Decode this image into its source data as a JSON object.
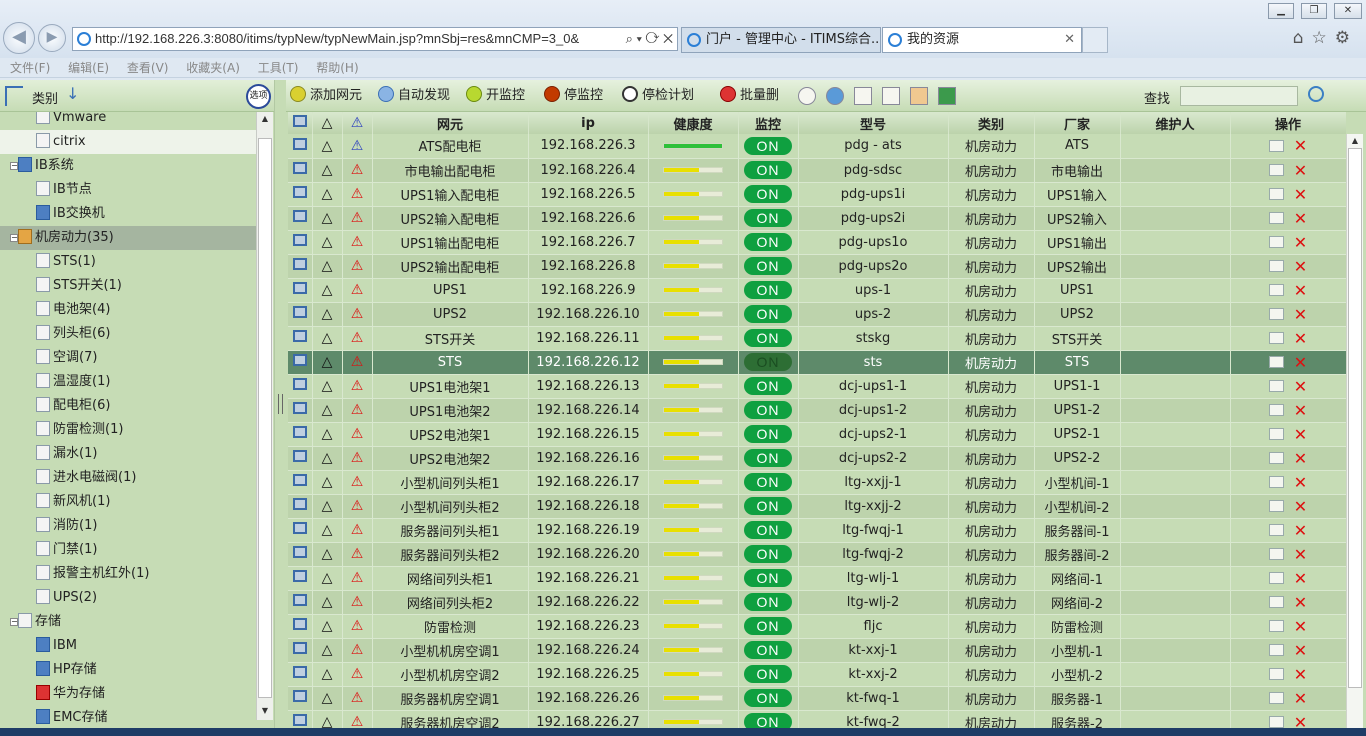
{
  "browser": {
    "url": "http://192.168.226.3:8080/itims/typNew/typNewMain.jsp?mnSbj=res&mnCMP=3_0&",
    "tabs": [
      {
        "label": "门户 - 管理中心 - ITIMS综合..."
      },
      {
        "label": "我的资源"
      }
    ]
  },
  "menu": [
    "文件(F)",
    "编辑(E)",
    "查看(V)",
    "收藏夹(A)",
    "工具(T)",
    "帮助(H)"
  ],
  "left": {
    "header_label": "类别",
    "options_label": "选项",
    "tree": [
      {
        "label": "Vmware",
        "level": 2,
        "icon": "vm"
      },
      {
        "label": "citrix",
        "level": 2,
        "icon": "citrix",
        "selected": true
      },
      {
        "label": "IB系统",
        "level": 1,
        "expander": "−",
        "icon": "ib"
      },
      {
        "label": "IB节点",
        "level": 2,
        "icon": "doc"
      },
      {
        "label": "IB交换机",
        "level": 2,
        "icon": "switch"
      },
      {
        "label": "机房动力(35)",
        "level": 1,
        "expander": "−",
        "icon": "power",
        "highlight": true
      },
      {
        "label": "STS(1)",
        "level": 2,
        "icon": "doc"
      },
      {
        "label": "STS开关(1)",
        "level": 2,
        "icon": "doc"
      },
      {
        "label": "电池架(4)",
        "level": 2,
        "icon": "doc"
      },
      {
        "label": "列头柜(6)",
        "level": 2,
        "icon": "doc"
      },
      {
        "label": "空调(7)",
        "level": 2,
        "icon": "doc"
      },
      {
        "label": "温湿度(1)",
        "level": 2,
        "icon": "doc"
      },
      {
        "label": "配电柜(6)",
        "level": 2,
        "icon": "doc"
      },
      {
        "label": "防雷检测(1)",
        "level": 2,
        "icon": "doc"
      },
      {
        "label": "漏水(1)",
        "level": 2,
        "icon": "doc"
      },
      {
        "label": "进水电磁阀(1)",
        "level": 2,
        "icon": "doc"
      },
      {
        "label": "新风机(1)",
        "level": 2,
        "icon": "doc"
      },
      {
        "label": "消防(1)",
        "level": 2,
        "icon": "doc"
      },
      {
        "label": "门禁(1)",
        "level": 2,
        "icon": "doc"
      },
      {
        "label": "报警主机红外(1)",
        "level": 2,
        "icon": "doc"
      },
      {
        "label": "UPS(2)",
        "level": 2,
        "icon": "doc"
      },
      {
        "label": "存储",
        "level": 1,
        "expander": "−",
        "icon": "storage"
      },
      {
        "label": "IBM",
        "level": 2,
        "icon": "ibm"
      },
      {
        "label": "HP存储",
        "level": 2,
        "icon": "hp"
      },
      {
        "label": "华为存储",
        "level": 2,
        "icon": "huawei"
      },
      {
        "label": "EMC存储",
        "level": 2,
        "icon": "emc"
      }
    ]
  },
  "toolbar": {
    "add": "添加网元",
    "discover": "自动发现",
    "start_monitor": "开监控",
    "stop_monitor": "停监控",
    "stop_plan": "停检计划",
    "batch_delete": "批量删",
    "search_label": "查找",
    "search_value": ""
  },
  "table": {
    "headers": [
      "网元",
      "ip",
      "健康度",
      "监控",
      "型号",
      "类别",
      "厂家",
      "维护人",
      "操作"
    ],
    "on_label": "ON",
    "rows": [
      {
        "name": "ATS配电柜",
        "ip": "192.168.226.3",
        "health": 1.0,
        "health_color": "#2fc03a",
        "monitor": "ON",
        "model": "pdg - ats",
        "category": "机房动力",
        "vendor": "ATS",
        "maintainer": "",
        "warn": "blue"
      },
      {
        "name": "市电输出配电柜",
        "ip": "192.168.226.4",
        "health": 0.6,
        "health_color": "#e8e000",
        "monitor": "ON",
        "model": "pdg-sdsc",
        "category": "机房动力",
        "vendor": "市电输出",
        "maintainer": "",
        "warn": "red"
      },
      {
        "name": "UPS1输入配电柜",
        "ip": "192.168.226.5",
        "health": 0.6,
        "health_color": "#e8e000",
        "monitor": "ON",
        "model": "pdg-ups1i",
        "category": "机房动力",
        "vendor": "UPS1输入",
        "maintainer": "",
        "warn": "red"
      },
      {
        "name": "UPS2输入配电柜",
        "ip": "192.168.226.6",
        "health": 0.6,
        "health_color": "#e8e000",
        "monitor": "ON",
        "model": "pdg-ups2i",
        "category": "机房动力",
        "vendor": "UPS2输入",
        "maintainer": "",
        "warn": "red"
      },
      {
        "name": "UPS1输出配电柜",
        "ip": "192.168.226.7",
        "health": 0.6,
        "health_color": "#e8e000",
        "monitor": "ON",
        "model": "pdg-ups1o",
        "category": "机房动力",
        "vendor": "UPS1输出",
        "maintainer": "",
        "warn": "red"
      },
      {
        "name": "UPS2输出配电柜",
        "ip": "192.168.226.8",
        "health": 0.6,
        "health_color": "#e8e000",
        "monitor": "ON",
        "model": "pdg-ups2o",
        "category": "机房动力",
        "vendor": "UPS2输出",
        "maintainer": "",
        "warn": "red"
      },
      {
        "name": "UPS1",
        "ip": "192.168.226.9",
        "health": 0.6,
        "health_color": "#e8e000",
        "monitor": "ON",
        "model": "ups-1",
        "category": "机房动力",
        "vendor": "UPS1",
        "maintainer": "",
        "warn": "red"
      },
      {
        "name": "UPS2",
        "ip": "192.168.226.10",
        "health": 0.6,
        "health_color": "#e8e000",
        "monitor": "ON",
        "model": "ups-2",
        "category": "机房动力",
        "vendor": "UPS2",
        "maintainer": "",
        "warn": "red"
      },
      {
        "name": "STS开关",
        "ip": "192.168.226.11",
        "health": 0.6,
        "health_color": "#e8e000",
        "monitor": "ON",
        "model": "stskg",
        "category": "机房动力",
        "vendor": "STS开关",
        "maintainer": "",
        "warn": "red"
      },
      {
        "name": "STS",
        "ip": "192.168.226.12",
        "health": 0.6,
        "health_color": "#e8e000",
        "monitor": "ON",
        "model": "sts",
        "category": "机房动力",
        "vendor": "STS",
        "maintainer": "",
        "warn": "red",
        "selected": true
      },
      {
        "name": "UPS1电池架1",
        "ip": "192.168.226.13",
        "health": 0.6,
        "health_color": "#e8e000",
        "monitor": "ON",
        "model": "dcj-ups1-1",
        "category": "机房动力",
        "vendor": "UPS1-1",
        "maintainer": "",
        "warn": "red"
      },
      {
        "name": "UPS1电池架2",
        "ip": "192.168.226.14",
        "health": 0.6,
        "health_color": "#e8e000",
        "monitor": "ON",
        "model": "dcj-ups1-2",
        "category": "机房动力",
        "vendor": "UPS1-2",
        "maintainer": "",
        "warn": "red"
      },
      {
        "name": "UPS2电池架1",
        "ip": "192.168.226.15",
        "health": 0.6,
        "health_color": "#e8e000",
        "monitor": "ON",
        "model": "dcj-ups2-1",
        "category": "机房动力",
        "vendor": "UPS2-1",
        "maintainer": "",
        "warn": "red"
      },
      {
        "name": "UPS2电池架2",
        "ip": "192.168.226.16",
        "health": 0.6,
        "health_color": "#e8e000",
        "monitor": "ON",
        "model": "dcj-ups2-2",
        "category": "机房动力",
        "vendor": "UPS2-2",
        "maintainer": "",
        "warn": "red"
      },
      {
        "name": "小型机间列头柜1",
        "ip": "192.168.226.17",
        "health": 0.6,
        "health_color": "#e8e000",
        "monitor": "ON",
        "model": "ltg-xxjj-1",
        "category": "机房动力",
        "vendor": "小型机间-1",
        "maintainer": "",
        "warn": "red"
      },
      {
        "name": "小型机间列头柜2",
        "ip": "192.168.226.18",
        "health": 0.6,
        "health_color": "#e8e000",
        "monitor": "ON",
        "model": "ltg-xxjj-2",
        "category": "机房动力",
        "vendor": "小型机间-2",
        "maintainer": "",
        "warn": "red"
      },
      {
        "name": "服务器间列头柜1",
        "ip": "192.168.226.19",
        "health": 0.6,
        "health_color": "#e8e000",
        "monitor": "ON",
        "model": "ltg-fwqj-1",
        "category": "机房动力",
        "vendor": "服务器间-1",
        "maintainer": "",
        "warn": "red"
      },
      {
        "name": "服务器间列头柜2",
        "ip": "192.168.226.20",
        "health": 0.6,
        "health_color": "#e8e000",
        "monitor": "ON",
        "model": "ltg-fwqj-2",
        "category": "机房动力",
        "vendor": "服务器间-2",
        "maintainer": "",
        "warn": "red"
      },
      {
        "name": "网络间列头柜1",
        "ip": "192.168.226.21",
        "health": 0.6,
        "health_color": "#e8e000",
        "monitor": "ON",
        "model": "ltg-wlj-1",
        "category": "机房动力",
        "vendor": "网络间-1",
        "maintainer": "",
        "warn": "red"
      },
      {
        "name": "网络间列头柜2",
        "ip": "192.168.226.22",
        "health": 0.6,
        "health_color": "#e8e000",
        "monitor": "ON",
        "model": "ltg-wlj-2",
        "category": "机房动力",
        "vendor": "网络间-2",
        "maintainer": "",
        "warn": "red"
      },
      {
        "name": "防雷检测",
        "ip": "192.168.226.23",
        "health": 0.6,
        "health_color": "#e8e000",
        "monitor": "ON",
        "model": "fljc",
        "category": "机房动力",
        "vendor": "防雷检测",
        "maintainer": "",
        "warn": "red"
      },
      {
        "name": "小型机机房空调1",
        "ip": "192.168.226.24",
        "health": 0.6,
        "health_color": "#e8e000",
        "monitor": "ON",
        "model": "kt-xxj-1",
        "category": "机房动力",
        "vendor": "小型机-1",
        "maintainer": "",
        "warn": "red"
      },
      {
        "name": "小型机机房空调2",
        "ip": "192.168.226.25",
        "health": 0.6,
        "health_color": "#e8e000",
        "monitor": "ON",
        "model": "kt-xxj-2",
        "category": "机房动力",
        "vendor": "小型机-2",
        "maintainer": "",
        "warn": "red"
      },
      {
        "name": "服务器机房空调1",
        "ip": "192.168.226.26",
        "health": 0.6,
        "health_color": "#e8e000",
        "monitor": "ON",
        "model": "kt-fwq-1",
        "category": "机房动力",
        "vendor": "服务器-1",
        "maintainer": "",
        "warn": "red"
      },
      {
        "name": "服务器机房空调2",
        "ip": "192.168.226.27",
        "health": 0.6,
        "health_color": "#e8e000",
        "monitor": "ON",
        "model": "kt-fwq-2",
        "category": "机房动力",
        "vendor": "服务器-2",
        "maintainer": "",
        "warn": "red"
      }
    ]
  }
}
